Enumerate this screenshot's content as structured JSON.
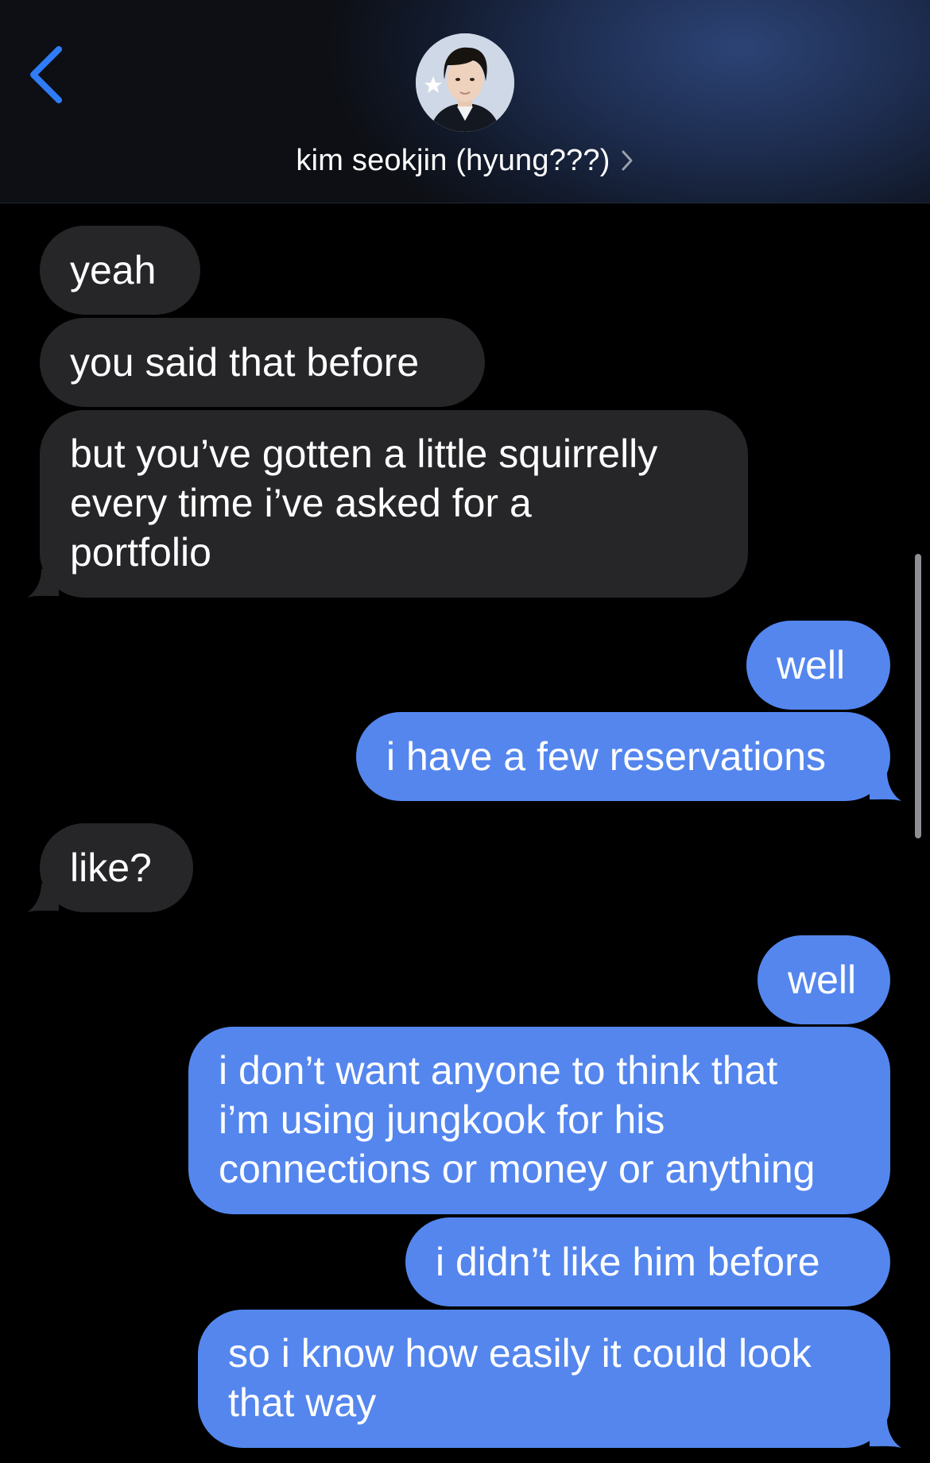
{
  "header": {
    "contact_name": "kim seokjin (hyung???)",
    "back_icon": "chevron-left-icon",
    "detail_icon": "chevron-right-icon",
    "accent_color": "#2f7cf6"
  },
  "messages": [
    {
      "from": "them",
      "text": "yeah"
    },
    {
      "from": "them",
      "text": "you said that before"
    },
    {
      "from": "them",
      "lines": [
        "but you’ve gotten a little squirrelly",
        "every time i’ve asked for a",
        "portfolio"
      ]
    },
    {
      "from": "me",
      "text": "well"
    },
    {
      "from": "me",
      "text": "i have a few reservations"
    },
    {
      "from": "them",
      "text": "like?"
    },
    {
      "from": "me",
      "text": "well"
    },
    {
      "from": "me",
      "lines": [
        "i don’t want anyone to think that",
        "i’m using jungkook for his",
        "connections or money or anything"
      ]
    },
    {
      "from": "me",
      "text": "i didn’t like him before"
    },
    {
      "from": "me",
      "lines": [
        "so i know how easily it could look",
        "that way"
      ]
    }
  ],
  "colors": {
    "received_bubble": "#262629",
    "sent_bubble": "#5486ee",
    "background": "#000000"
  }
}
